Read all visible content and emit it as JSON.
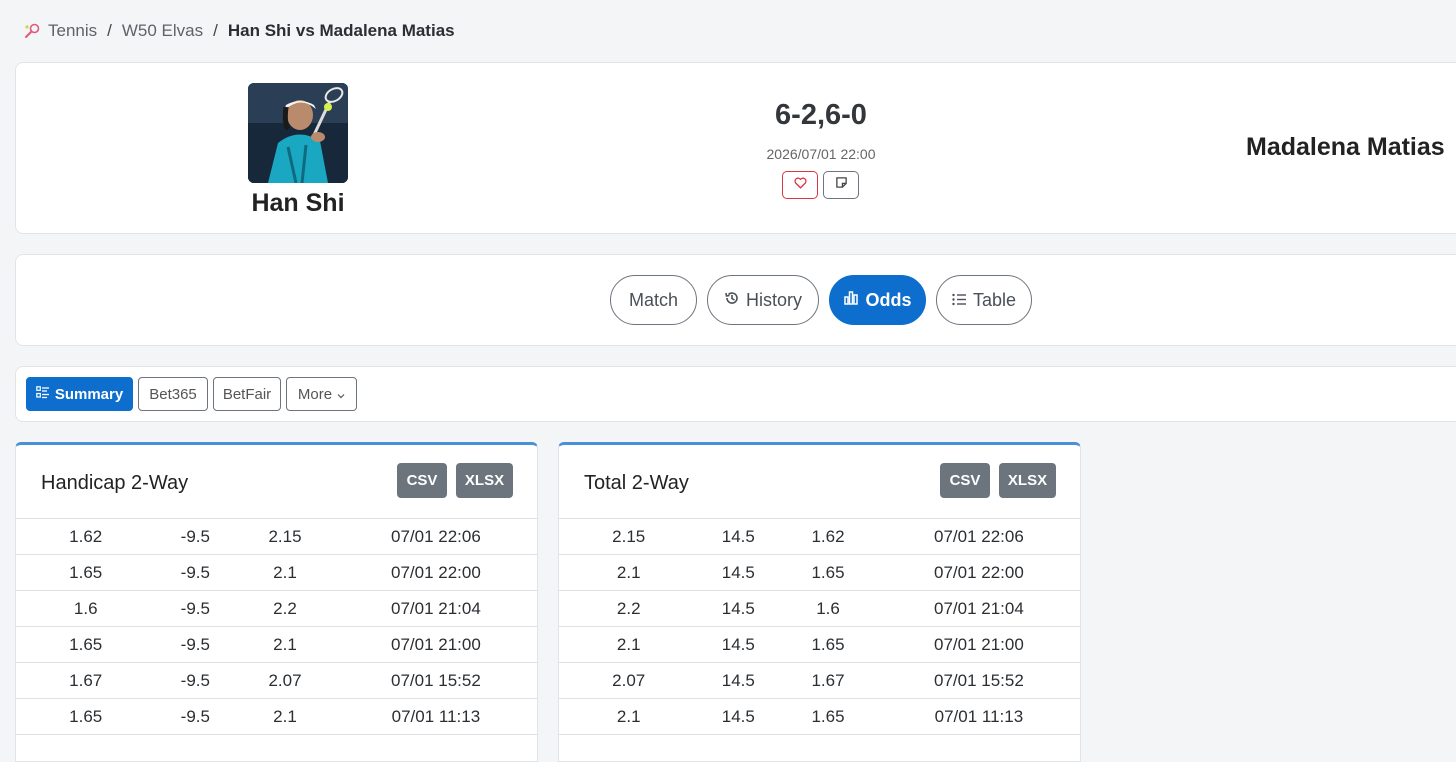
{
  "breadcrumb": {
    "items": [
      "Tennis",
      "W50 Elvas",
      "Han Shi vs Madalena Matias"
    ]
  },
  "match": {
    "player1": "Han Shi",
    "player2": "Madalena Matias",
    "score": "6-2,6-0",
    "datetime": "2026/07/01 22:00"
  },
  "tabs": [
    {
      "label": "Match",
      "icon": "none"
    },
    {
      "label": "History",
      "icon": "history-icon"
    },
    {
      "label": "Odds",
      "icon": "bar-chart-icon",
      "active": true
    },
    {
      "label": "Table",
      "icon": "list-icon"
    }
  ],
  "bookmakers": [
    {
      "label": "Summary",
      "icon": "list-check-icon",
      "active": true
    },
    {
      "label": "Bet365"
    },
    {
      "label": "BetFair"
    },
    {
      "label": "More",
      "icon": "chevron-down-icon"
    }
  ],
  "colors": {
    "primary": "#0d6ecd",
    "secondary": "#6c757d",
    "danger": "#dc3545",
    "card_accent": "#4a90d9"
  },
  "handicap": {
    "title": "Handicap 2-Way",
    "csv": "CSV",
    "xlsx": "XLSX",
    "rows": [
      [
        "1.62",
        "-9.5",
        "2.15",
        "07/01 22:06"
      ],
      [
        "1.65",
        "-9.5",
        "2.1",
        "07/01 22:00"
      ],
      [
        "1.6",
        "-9.5",
        "2.2",
        "07/01 21:04"
      ],
      [
        "1.65",
        "-9.5",
        "2.1",
        "07/01 21:00"
      ],
      [
        "1.67",
        "-9.5",
        "2.07",
        "07/01 15:52"
      ],
      [
        "1.65",
        "-9.5",
        "2.1",
        "07/01 11:13"
      ]
    ]
  },
  "total": {
    "title": "Total 2-Way",
    "csv": "CSV",
    "xlsx": "XLSX",
    "rows": [
      [
        "2.15",
        "14.5",
        "1.62",
        "07/01 22:06"
      ],
      [
        "2.1",
        "14.5",
        "1.65",
        "07/01 22:00"
      ],
      [
        "2.2",
        "14.5",
        "1.6",
        "07/01 21:04"
      ],
      [
        "2.1",
        "14.5",
        "1.65",
        "07/01 21:00"
      ],
      [
        "2.07",
        "14.5",
        "1.67",
        "07/01 15:52"
      ],
      [
        "2.1",
        "14.5",
        "1.65",
        "07/01 11:13"
      ]
    ]
  }
}
